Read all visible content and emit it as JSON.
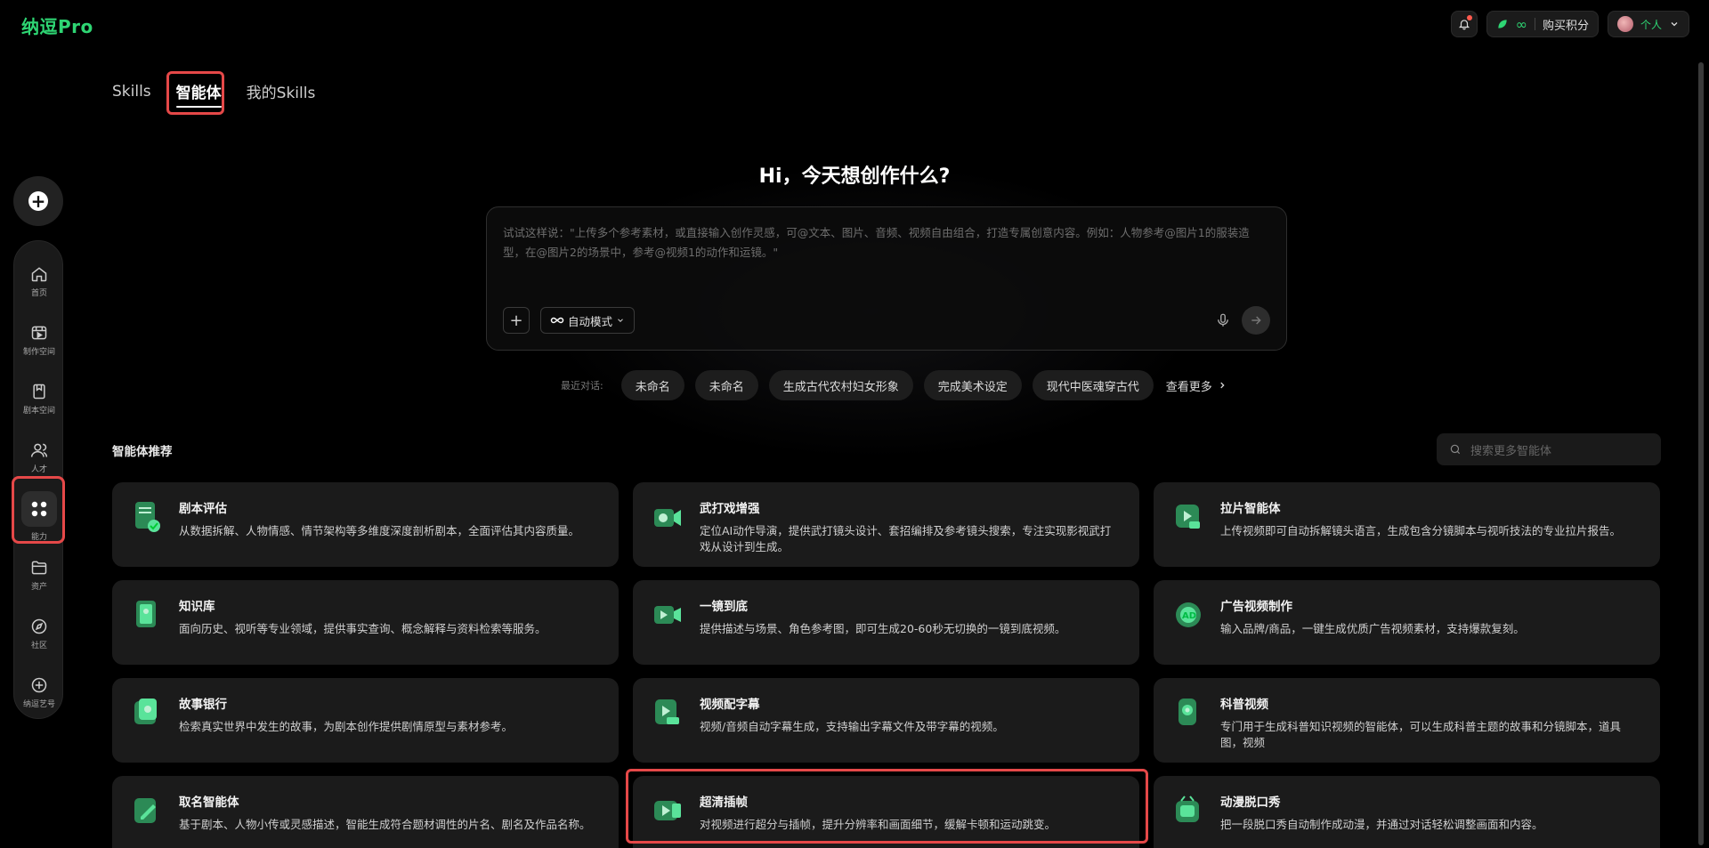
{
  "app": {
    "logo": "纳逗Pro"
  },
  "topbar": {
    "credits_icon": "infinity-icon",
    "credits_value": "∞",
    "buy_label": "购买积分",
    "user_label": "个人"
  },
  "tabs": [
    {
      "label": "Skills"
    },
    {
      "label": "智能体"
    },
    {
      "label": "我的Skills"
    }
  ],
  "active_tab": "智能体",
  "sidebar": {
    "items": [
      {
        "label": "首页",
        "icon": "home-icon"
      },
      {
        "label": "制作空间",
        "icon": "workspace-icon"
      },
      {
        "label": "剧本空间",
        "icon": "script-icon"
      },
      {
        "label": "人才",
        "icon": "people-icon"
      },
      {
        "label": "能力",
        "icon": "grid-icon"
      },
      {
        "label": "资产",
        "icon": "folder-icon"
      },
      {
        "label": "社区",
        "icon": "compass-icon"
      },
      {
        "label": "纳逗艺号",
        "icon": "nadou-icon"
      }
    ],
    "active_index": 4
  },
  "hero": {
    "title": "Hi，今天想创作什么?",
    "placeholder": "试试这样说：\"上传多个参考素材，或直接输入创作灵感，可@文本、图片、音频、视频自由组合，打造专属创意内容。例如：人物参考@图片1的服装造型，在@图片2的场景中，参考@视频1的动作和运镜。\"",
    "mode_label": "自动模式"
  },
  "recent": {
    "label": "最近对话:",
    "chips": [
      "未命名",
      "未命名",
      "生成古代农村妇女形象",
      "完成美术设定",
      "现代中医魂穿古代"
    ],
    "more_label": "查看更多"
  },
  "agents": {
    "section_title": "智能体推荐",
    "search_placeholder": "搜索更多智能体",
    "cards": [
      {
        "title": "剧本评估",
        "desc": "从数据拆解、人物情感、情节架构等多维度深度剖析剧本，全面评估其内容质量。"
      },
      {
        "title": "武打戏增强",
        "desc": "定位AI动作导演，提供武打镜头设计、套招编排及参考镜头搜索，专注实现影视武打戏从设计到生成。"
      },
      {
        "title": "拉片智能体",
        "desc": "上传视频即可自动拆解镜头语言，生成包含分镜脚本与视听技法的专业拉片报告。"
      },
      {
        "title": "知识库",
        "desc": "面向历史、视听等专业领域，提供事实查询、概念解释与资料检索等服务。"
      },
      {
        "title": "一镜到底",
        "desc": "提供描述与场景、角色参考图，即可生成20-60秒无切换的一镜到底视频。"
      },
      {
        "title": "广告视频制作",
        "desc": "输入品牌/商品，一键生成优质广告视频素材，支持爆款复刻。"
      },
      {
        "title": "故事银行",
        "desc": "检索真实世界中发生的故事，为剧本创作提供剧情原型与素材参考。"
      },
      {
        "title": "视频配字幕",
        "desc": "视频/音频自动字幕生成，支持输出字幕文件及带字幕的视频。"
      },
      {
        "title": "科普视频",
        "desc": "专门用于生成科普知识视频的智能体，可以生成科普主题的故事和分镜脚本，道具图，视频"
      },
      {
        "title": "取名智能体",
        "desc": "基于剧本、人物小传或灵感描述，智能生成符合题材调性的片名、剧名及作品名称。"
      },
      {
        "title": "超清插帧",
        "desc": "对视频进行超分与插帧，提升分辨率和画面细节，缓解卡顿和运动跳变。"
      },
      {
        "title": "动漫脱口秀",
        "desc": "把一段脱口秀自动制作成动漫，并通过对话轻松调整画面和内容。"
      }
    ]
  },
  "colors": {
    "brand": "#2ed573",
    "highlight": "#e54848",
    "card": "#1b1b1b"
  }
}
